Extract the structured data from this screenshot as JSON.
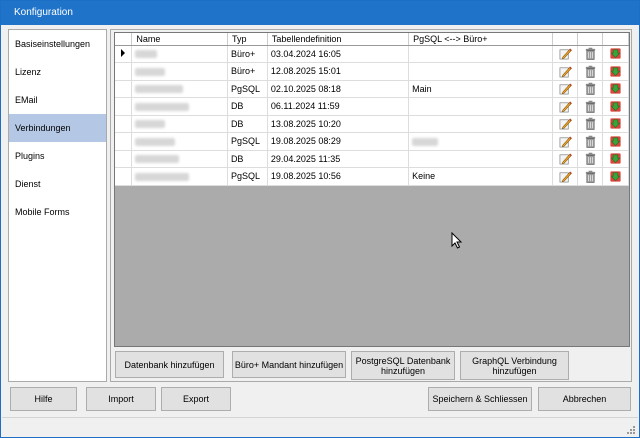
{
  "window": {
    "title": "Konfiguration"
  },
  "sidebar": {
    "items": [
      {
        "label": "Basiseinstellungen"
      },
      {
        "label": "Lizenz"
      },
      {
        "label": "EMail"
      },
      {
        "label": "Verbindungen"
      },
      {
        "label": "Plugins"
      },
      {
        "label": "Dienst"
      },
      {
        "label": "Mobile Forms"
      }
    ],
    "active_index": 3
  },
  "grid": {
    "columns": [
      "Name",
      "Typ",
      "Tabellendefinition",
      "PgSQL <--> Büro+"
    ],
    "rows": [
      {
        "typ": "Büro+",
        "tabellendefinition": "03.04.2024 16:05",
        "pgsql": ""
      },
      {
        "typ": "Büro+",
        "tabellendefinition": "12.08.2025 15:01",
        "pgsql": ""
      },
      {
        "typ": "PgSQL",
        "tabellendefinition": "02.10.2025 08:18",
        "pgsql": "Main"
      },
      {
        "typ": "DB",
        "tabellendefinition": "06.11.2024 11:59",
        "pgsql": ""
      },
      {
        "typ": "DB",
        "tabellendefinition": "13.08.2025 10:20",
        "pgsql": ""
      },
      {
        "typ": "PgSQL",
        "tabellendefinition": "19.08.2025 08:29",
        "pgsql": ""
      },
      {
        "typ": "DB",
        "tabellendefinition": "29.04.2025 11:35",
        "pgsql": ""
      },
      {
        "typ": "PgSQL",
        "tabellendefinition": "19.08.2025 10:56",
        "pgsql": "Keine"
      }
    ],
    "row_icons": [
      "edit-icon",
      "trash-icon",
      "download-icon"
    ]
  },
  "actions": {
    "add_database": "Datenbank hinzufügen",
    "add_buero_mandant": "Büro+ Mandant hinzufügen",
    "add_postgresql_line1": "PostgreSQL Datenbank",
    "add_postgresql_line2": "hinzufügen",
    "add_graphql_line1": "GraphQL Verbindung",
    "add_graphql_line2": "hinzufügen"
  },
  "footer": {
    "help": "Hilfe",
    "import": "Import",
    "export": "Export",
    "save_close": "Speichern & Schliessen",
    "cancel": "Abbrechen"
  }
}
